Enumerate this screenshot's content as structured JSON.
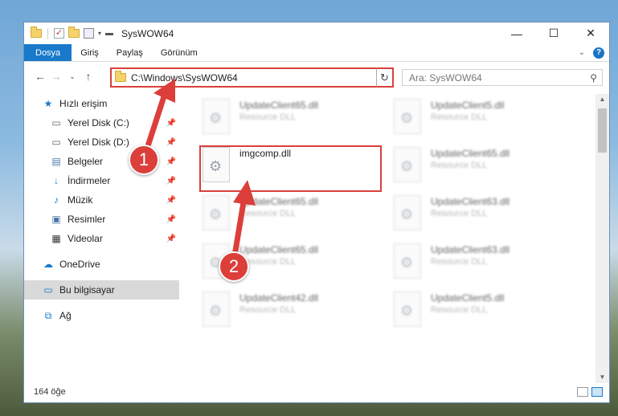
{
  "window": {
    "title": "SysWOW64"
  },
  "ribbon": {
    "tabs": [
      "Dosya",
      "Giriş",
      "Paylaş",
      "Görünüm"
    ],
    "help": "?"
  },
  "address": {
    "path": "C:\\Windows\\SysWOW64"
  },
  "search": {
    "placeholder": "Ara: SysWOW64"
  },
  "sidebar": {
    "quick_access": "Hızlı erişim",
    "items": [
      {
        "label": "Yerel Disk (C:)",
        "icon": "drive-icon"
      },
      {
        "label": "Yerel Disk (D:)",
        "icon": "drive-icon"
      },
      {
        "label": "Belgeler",
        "icon": "documents-icon"
      },
      {
        "label": "İndirmeler",
        "icon": "download-icon"
      },
      {
        "label": "Müzik",
        "icon": "music-icon"
      },
      {
        "label": "Resimler",
        "icon": "pictures-icon"
      },
      {
        "label": "Videolar",
        "icon": "videos-icon"
      }
    ],
    "onedrive": "OneDrive",
    "this_pc": "Bu bilgisayar",
    "network": "Ağ"
  },
  "files": [
    {
      "name": "UpdateClient65.dll",
      "type": "Resource DLL",
      "blurred": true
    },
    {
      "name": "UpdateClient5.dll",
      "type": "Resource DLL",
      "blurred": true
    },
    {
      "name": "imgcomp.dll",
      "type": "",
      "blurred": false
    },
    {
      "name": "UpdateClient65.dll",
      "type": "Resource DLL",
      "blurred": true
    },
    {
      "name": "UpdateClient65.dll",
      "type": "Resource DLL",
      "blurred": true
    },
    {
      "name": "UpdateClient63.dll",
      "type": "Resource DLL",
      "blurred": true
    },
    {
      "name": "UpdateClient65.dll",
      "type": "Resource DLL",
      "blurred": true
    },
    {
      "name": "UpdateClient63.dll",
      "type": "Resource DLL",
      "blurred": true
    },
    {
      "name": "UpdateClient42.dll",
      "type": "Resource DLL",
      "blurred": true
    },
    {
      "name": "UpdateClient5.dll",
      "type": "Resource DLL",
      "blurred": true
    }
  ],
  "status": {
    "count": "164 öğe"
  },
  "annotations": {
    "step1": "1",
    "step2": "2"
  },
  "colors": {
    "accent": "#1979ca",
    "highlight": "#d9403a"
  }
}
